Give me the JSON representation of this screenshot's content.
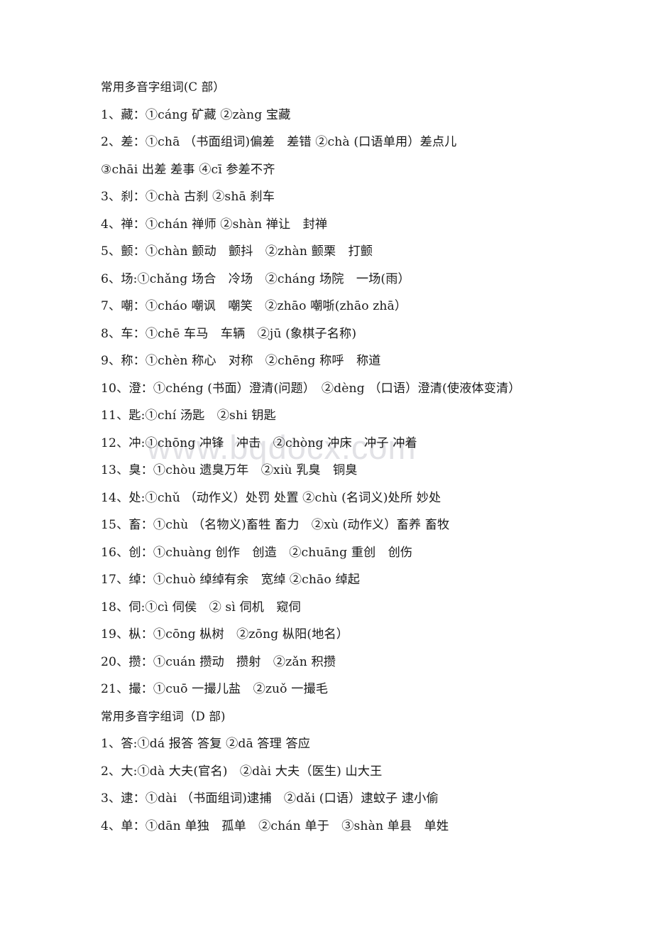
{
  "document": {
    "watermark": "www.bqdocx.com",
    "lines": [
      {
        "id": "heading-c",
        "type": "heading",
        "text": "常用多音字组词(C 部）"
      },
      {
        "id": "c-1",
        "type": "entry",
        "text": "1、藏：①cáng 矿藏 ②zàng 宝藏"
      },
      {
        "id": "c-2a",
        "type": "entry",
        "text": "2、差：①chā （书面组词)偏差　差错 ②chà (口语单用）差点儿"
      },
      {
        "id": "c-2b",
        "type": "entry",
        "text": "③chāi 出差 差事 ④cī 参差不齐"
      },
      {
        "id": "c-3",
        "type": "entry",
        "text": "3、刹：①chà 古刹 ②shā 刹车"
      },
      {
        "id": "c-4",
        "type": "entry",
        "text": "4、禅：①chán 禅师 ②shàn 禅让　封禅"
      },
      {
        "id": "c-5",
        "type": "entry",
        "text": "5、颤：①chàn 颤动　颤抖　②zhàn 颤栗　打颤"
      },
      {
        "id": "c-6",
        "type": "entry",
        "text": "6、场:①chǎng 场合　冷场　②cháng 场院　一场(雨）"
      },
      {
        "id": "c-7",
        "type": "entry",
        "text": "7、嘲：①cháo 嘲讽　嘲笑　②zhāo 嘲哳(zhāo zhā）"
      },
      {
        "id": "c-8",
        "type": "entry",
        "text": "8、车：①chē 车马　车辆　②jū (象棋子名称)"
      },
      {
        "id": "c-9",
        "type": "entry",
        "text": "9、称：①chèn 称心　对称　②chēng 称呼　称道"
      },
      {
        "id": "c-10",
        "type": "entry",
        "text": "10、澄：①chéng (书面）澄清(问题）　②dèng （口语）澄清(使液体变清）"
      },
      {
        "id": "c-11",
        "type": "entry",
        "text": "11、匙:①chí 汤匙　②shi 钥匙"
      },
      {
        "id": "c-12",
        "type": "entry",
        "text": "12、冲:①chōng 冲锋　冲击　②chòng 冲床　冲子 冲着"
      },
      {
        "id": "c-13",
        "type": "entry",
        "text": "13、臭：①chòu 遗臭万年　②xiù 乳臭　铜臭"
      },
      {
        "id": "c-14",
        "type": "entry",
        "text": "14、处:①chǔ （动作义）处罚 处置 ②chù (名词义)处所 妙处"
      },
      {
        "id": "c-15",
        "type": "entry",
        "text": "15、畜：①chù （名物义)畜牲 畜力　②xù (动作义）畜养 畜牧"
      },
      {
        "id": "c-16",
        "type": "entry",
        "text": "16、创：①chuàng 创作　创造　②chuāng 重创　创伤"
      },
      {
        "id": "c-17",
        "type": "entry",
        "text": "17、绰：①chuò 绰绰有余　宽绰 ②chāo 绰起"
      },
      {
        "id": "c-18",
        "type": "entry",
        "text": "18、伺:①cì 伺侯　② sì 伺机　窥伺"
      },
      {
        "id": "c-19",
        "type": "entry",
        "text": "19、枞：①cōng 枞树　②zōng 枞阳(地名）"
      },
      {
        "id": "c-20",
        "type": "entry",
        "text": "20、攒：①cuán 攒动　攒射　②zǎn 积攒"
      },
      {
        "id": "c-21",
        "type": "entry",
        "text": "21、撮：①cuō 一撮儿盐　②zuǒ 一撮毛"
      },
      {
        "id": "heading-d",
        "type": "heading",
        "text": "常用多音字组词（D 部)"
      },
      {
        "id": "d-1",
        "type": "entry",
        "text": "1、答:①dá 报答 答复 ②dā 答理 答应"
      },
      {
        "id": "d-2",
        "type": "entry",
        "text": "2、大:①dà 大夫(官名)　②dài 大夫（医生) 山大王"
      },
      {
        "id": "d-3",
        "type": "entry",
        "text": "3、逮：①dài （书面组词)逮捕　②dǎi (口语）逮蚊子 逮小偷"
      },
      {
        "id": "d-4",
        "type": "entry",
        "text": "4、单：①dān 单独　孤单　②chán 单于　③shàn 单县　单姓"
      }
    ]
  }
}
